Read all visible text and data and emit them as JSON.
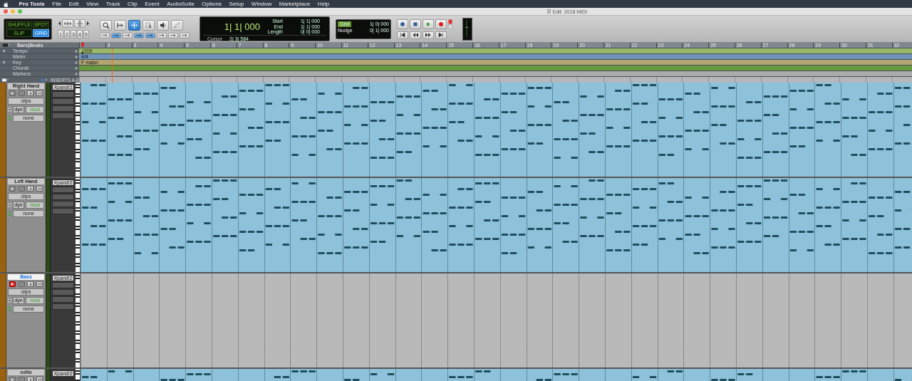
{
  "menu_bar": {
    "app": "Pro Tools",
    "items": [
      "File",
      "Edit",
      "View",
      "Track",
      "Clip",
      "Event",
      "AudioSuite",
      "Options",
      "Setup",
      "Window",
      "Marketplace",
      "Help"
    ]
  },
  "window": {
    "title": "Edit: 2018 MIDI"
  },
  "edit_modes": [
    {
      "label": "SHUFFLE",
      "selected": false
    },
    {
      "label": "SPOT",
      "selected": false
    },
    {
      "label": "SLIP",
      "selected": false
    },
    {
      "label": "GRID",
      "selected": true
    }
  ],
  "zoom_presets": [
    "1",
    "2",
    "3",
    "4",
    "5"
  ],
  "tools": [
    {
      "kind": "zoom",
      "selected": false
    },
    {
      "kind": "trim",
      "selected": false
    },
    {
      "kind": "grabber",
      "selected": true
    },
    {
      "kind": "scrub",
      "selected": false
    },
    {
      "kind": "speaker",
      "selected": false
    },
    {
      "kind": "pencil",
      "selected": false
    }
  ],
  "counter": {
    "main": "1| 1| 000",
    "start_label": "Start",
    "start": "1| 1| 000",
    "end_label": "End",
    "end": "1| 1| 000",
    "length_label": "Length",
    "length": "0| 0| 000",
    "cursor_label": "Cursor",
    "cursor": "2| 3| 584"
  },
  "grid": {
    "label": "Grid",
    "value": "1| 0| 000"
  },
  "nudge": {
    "label": "Nudge",
    "value": "0| 1| 000"
  },
  "rulers": {
    "timebase": "Bars|Beats",
    "bars": [
      "2",
      "3",
      "4",
      "5",
      "6",
      "7",
      "8",
      "9",
      "10",
      "11",
      "12",
      "13",
      "14",
      "15",
      "16",
      "17",
      "18",
      "19",
      "20",
      "21",
      "22",
      "23",
      "24",
      "25",
      "26",
      "27",
      "28",
      "29",
      "30",
      "31",
      "32"
    ],
    "rows": [
      {
        "label": "Tempo",
        "expandable": true,
        "value": "200",
        "kind": "tempo"
      },
      {
        "label": "Meter",
        "expandable": false,
        "value": "4/4",
        "kind": "meter"
      },
      {
        "label": "Key",
        "expandable": true,
        "value": "F major",
        "kind": "key"
      },
      {
        "label": "Chords",
        "expandable": false,
        "value": "",
        "kind": "chords"
      },
      {
        "label": "Markers",
        "expandable": false,
        "value": "",
        "kind": "markers"
      }
    ]
  },
  "inserts_header": "INSERTS A-E",
  "tracks": [
    {
      "name": "Right Hand",
      "name_selected": false,
      "record_armed": false,
      "has_clip": true,
      "view": "clips",
      "automation": "dyn",
      "automation_value": "mod",
      "group": "none",
      "insert": "Xpand!2"
    },
    {
      "name": "Left Hand",
      "name_selected": false,
      "record_armed": false,
      "has_clip": true,
      "view": "clips",
      "automation": "dyn",
      "automation_value": "mod",
      "group": "none",
      "insert": "Xpand!2"
    },
    {
      "name": "Bass",
      "name_selected": true,
      "record_armed": true,
      "has_clip": false,
      "view": "clips",
      "automation": "dyn",
      "automation_value": "mod",
      "group": "none",
      "insert": "Xpand!2"
    },
    {
      "name": "cello",
      "name_selected": false,
      "record_armed": false,
      "has_clip": true,
      "insert": "Xpand!2"
    }
  ]
}
